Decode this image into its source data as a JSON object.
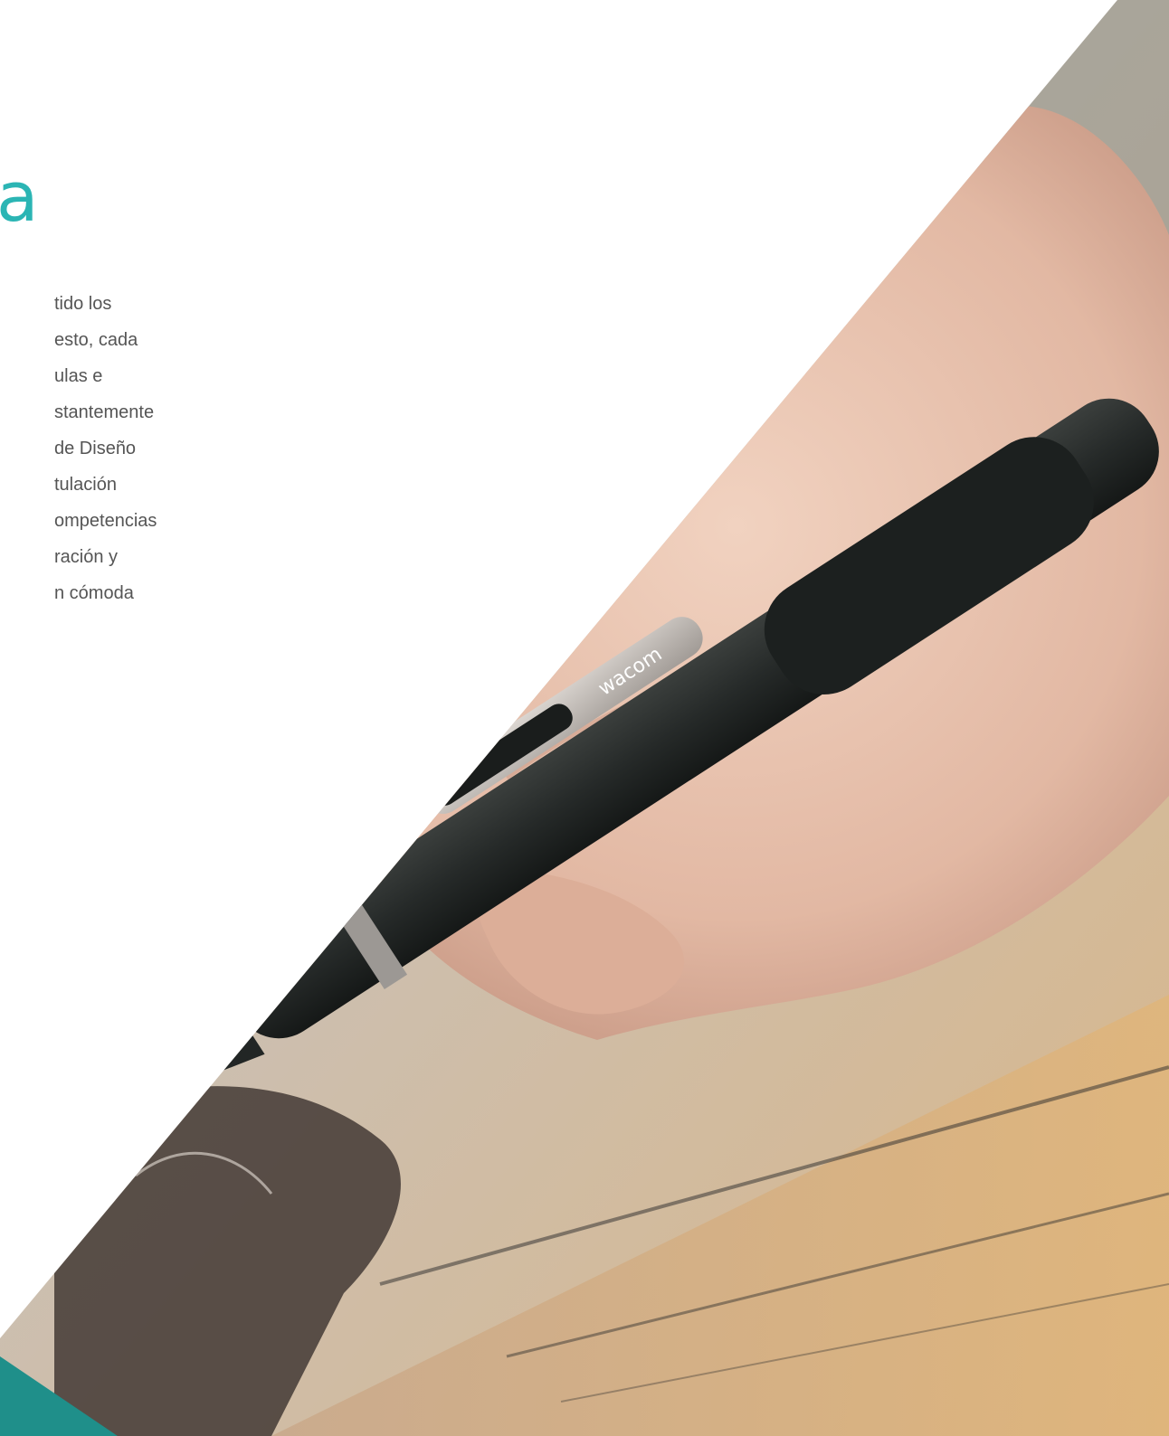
{
  "heading": {
    "fragment": "a"
  },
  "paragraph": {
    "lines": [
      "tido los",
      " esto, cada",
      "ulas e",
      "stantemente",
      " de Diseño",
      "tulación",
      "ompetencias",
      "ración y",
      "n cómoda"
    ]
  },
  "photo": {
    "brand_clip_text": "wacom"
  },
  "colors": {
    "accent": "#2bb5b4",
    "corner": "#1f8f8a",
    "body_text": "#555555"
  }
}
